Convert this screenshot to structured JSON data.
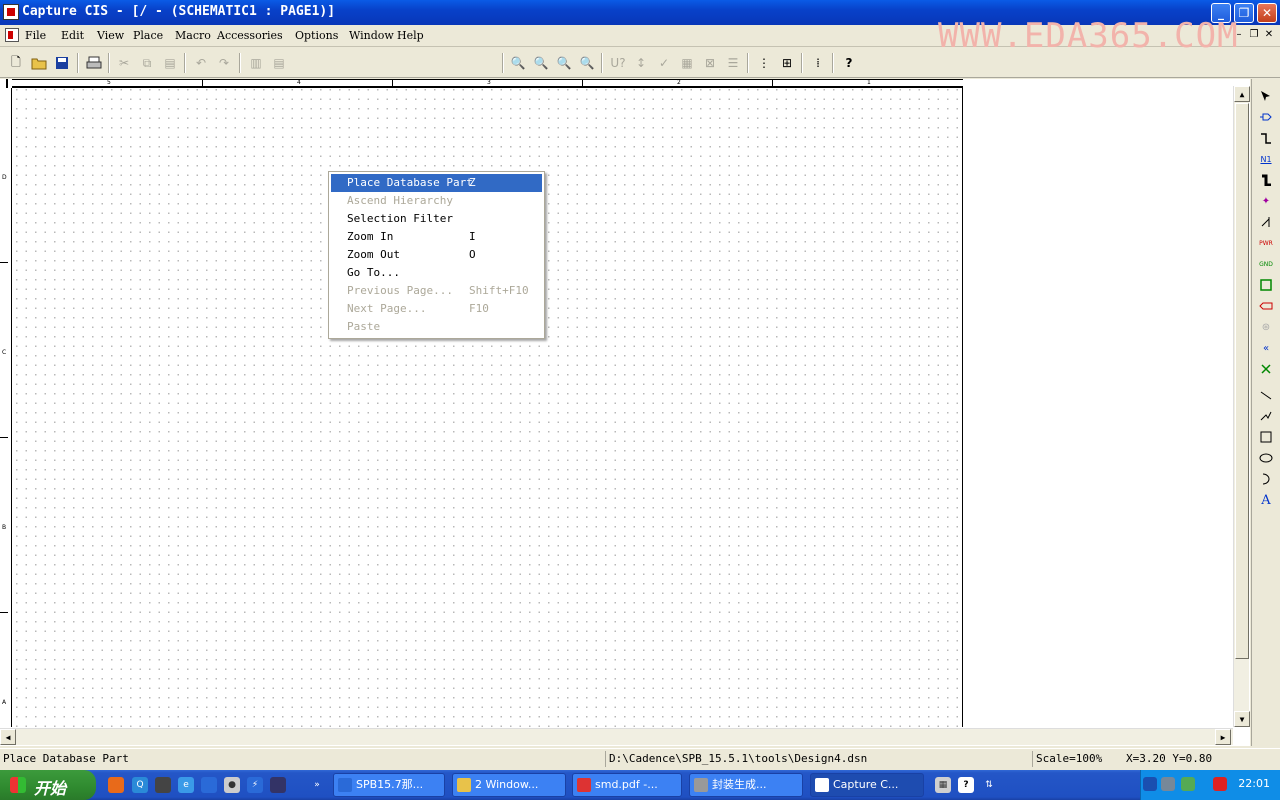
{
  "window": {
    "title": "Capture CIS - [/ - (SCHEMATIC1 : PAGE1)]",
    "controls": {
      "minimize": "_",
      "restore": "❐",
      "close": "✕"
    }
  },
  "menubar": {
    "items": [
      "File",
      "Edit",
      "View",
      "Place",
      "Macro",
      "Accessories",
      "Options",
      "Window",
      "Help"
    ],
    "watermark": "WWW.EDA365.COM",
    "mdi_controls": {
      "minimize": "–",
      "restore": "❐",
      "close": "✕"
    }
  },
  "toolbar": {
    "buttons": [
      "new-icon",
      "open-icon",
      "save-icon",
      "print-icon",
      "cut-icon",
      "copy-icon",
      "paste-icon",
      "undo-icon",
      "redo-icon",
      "split-h-icon",
      "split-v-icon",
      "zoom-in-icon",
      "zoom-out-icon",
      "zoom-area-icon",
      "zoom-all-icon",
      "annotate-icon",
      "back-annotate-icon",
      "drc-icon",
      "netlist-icon",
      "crossref-icon",
      "bom-icon",
      "snap-grid-icon",
      "project-manager-icon",
      "help-icon"
    ],
    "part_combo_value": ""
  },
  "rulers": {
    "top_labels": [
      "5",
      "4",
      "3",
      "2",
      "1"
    ],
    "left_labels": [
      "D",
      "C",
      "B",
      "A"
    ]
  },
  "context_menu": {
    "items": [
      {
        "label": "Place Database Part",
        "shortcut": "Z",
        "state": "selected"
      },
      {
        "label": "Ascend Hierarchy",
        "shortcut": "",
        "state": "disabled"
      },
      {
        "label": "Selection Filter",
        "shortcut": "",
        "state": "enabled"
      },
      {
        "label": "Zoom In",
        "shortcut": "I",
        "state": "enabled"
      },
      {
        "label": "Zoom Out",
        "shortcut": "O",
        "state": "enabled"
      },
      {
        "label": "Go To...",
        "shortcut": "",
        "state": "enabled"
      },
      {
        "label": "Previous Page...",
        "shortcut": "Shift+F10",
        "state": "disabled"
      },
      {
        "label": "Next Page...",
        "shortcut": "F10",
        "state": "disabled"
      },
      {
        "label": "Paste",
        "shortcut": "",
        "state": "disabled"
      }
    ]
  },
  "palette": {
    "tools": [
      "select-icon",
      "place-part-icon",
      "place-wire-icon",
      "net-alias-icon",
      "place-bus-icon",
      "junction-icon",
      "bus-entry-icon",
      "power-icon",
      "ground-icon",
      "hierarchical-block-icon",
      "hierarchical-port-icon",
      "hierarchical-pin-icon",
      "off-page-connector-icon",
      "no-connect-icon",
      "line-icon",
      "polyline-icon",
      "rectangle-icon",
      "ellipse-icon",
      "arc-icon",
      "text-icon"
    ],
    "labels": {
      "net_alias": "N1",
      "power": "PWR",
      "ground": "GND",
      "text": "A"
    }
  },
  "statusbar": {
    "message": "Place Database Part",
    "path": "D:\\Cadence\\SPB_15.5.1\\tools\\Design4.dsn",
    "scale": "Scale=100%",
    "coords": "X=3.20  Y=0.80"
  },
  "taskbar": {
    "start_label": "开始",
    "tasks": [
      {
        "label": "SPB15.7那...",
        "active": false
      },
      {
        "label": "2 Window...",
        "active": false
      },
      {
        "label": "smd.pdf -...",
        "active": false
      },
      {
        "label": "封装生成...",
        "active": false
      },
      {
        "label": "Capture C...",
        "active": true
      }
    ],
    "clock": "22:01"
  },
  "colors": {
    "titlebar": "#0841c9",
    "menu_highlight": "#316ac5",
    "watermark": "#f2b3ab",
    "taskbar": "#2456c7"
  }
}
